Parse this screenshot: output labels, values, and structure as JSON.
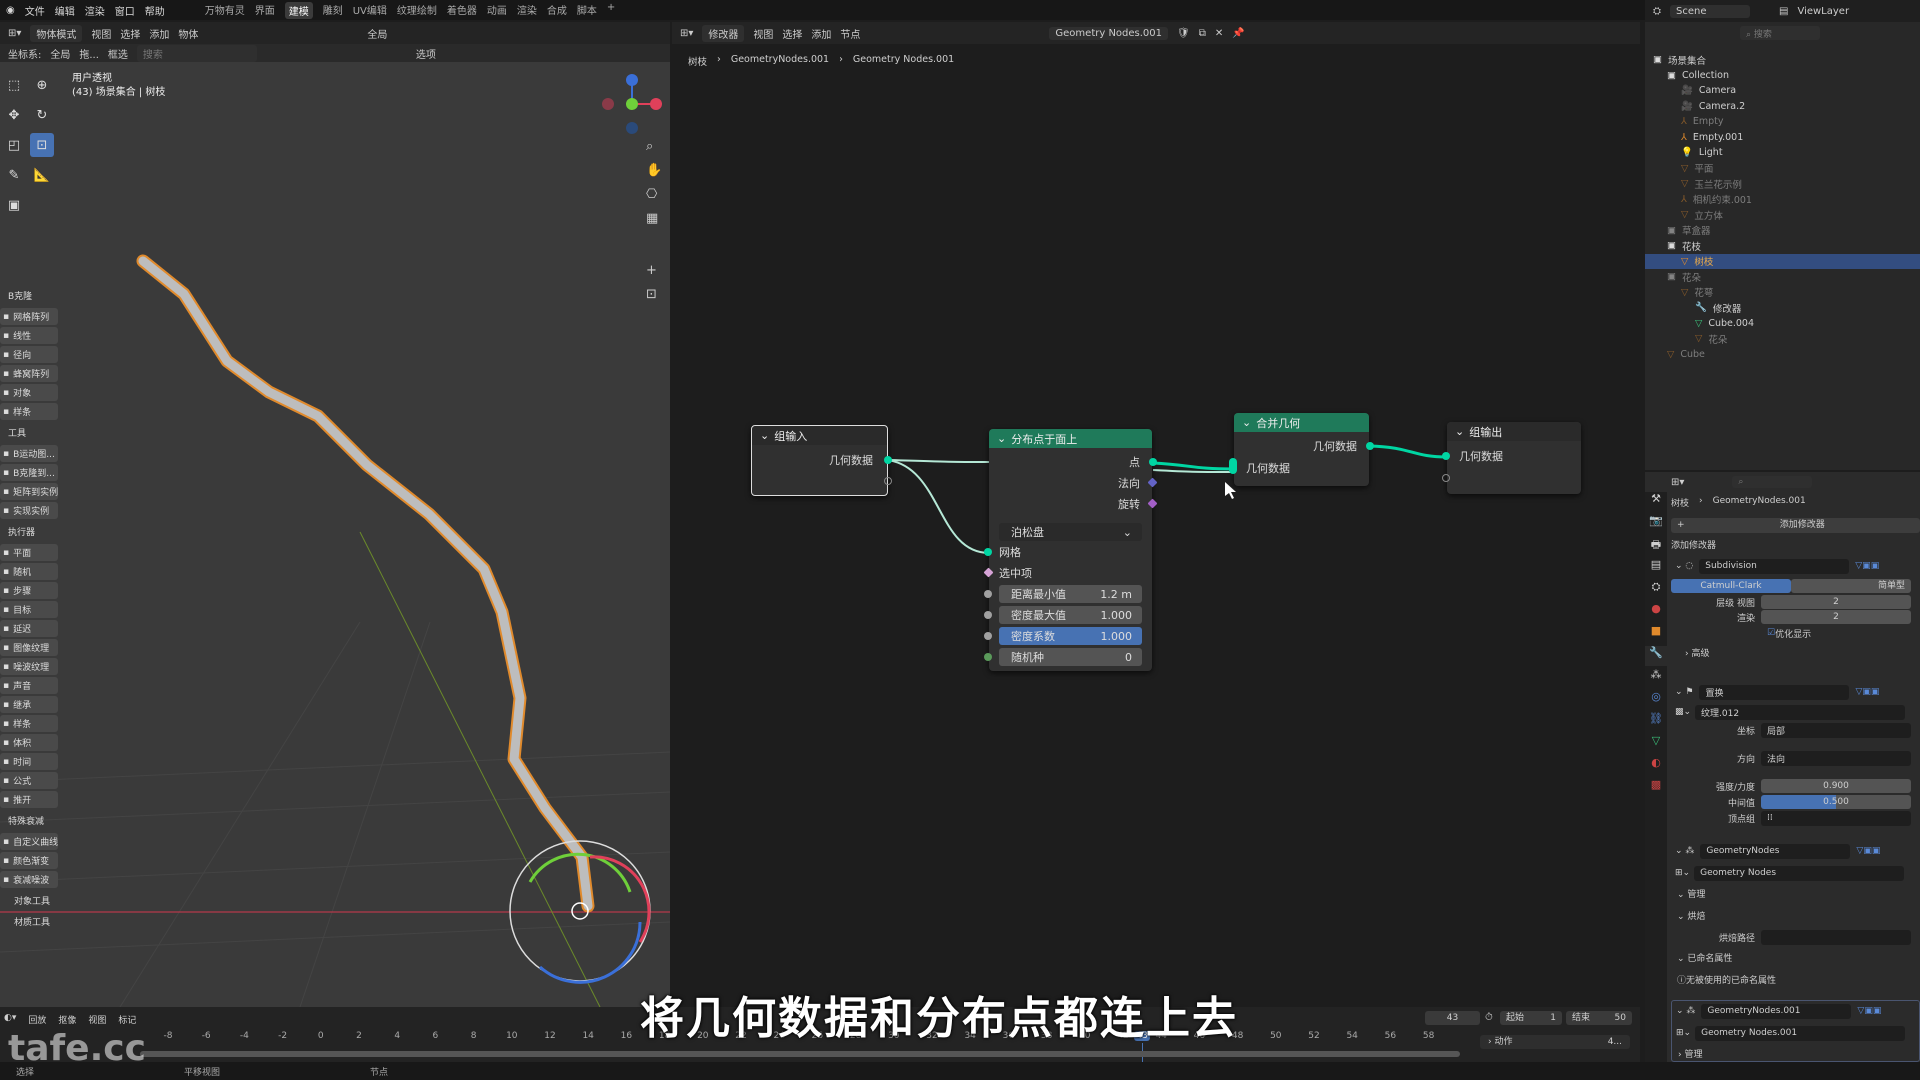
{
  "menu": {
    "items": [
      "文件",
      "编辑",
      "渲染",
      "窗口",
      "帮助"
    ],
    "workspaces": [
      "万物有灵",
      "界面",
      "建模",
      "雕刻",
      "UV编辑",
      "纹理绘制",
      "着色器",
      "动画",
      "渲染",
      "合成",
      "脚本",
      "+"
    ],
    "active_workspace": "建模"
  },
  "viewport_header": {
    "mode": "物体模式",
    "menus": [
      "视图",
      "选择",
      "添加",
      "物体"
    ],
    "transform": "全局",
    "coords_label": "坐标系:",
    "coords_value": "全局",
    "drag": "拖...",
    "select": "框选",
    "options": "选项",
    "search_placeholder": "搜索"
  },
  "viewport": {
    "view_name": "用户透视",
    "scene_info": "(43) 场景集合 | 树枝"
  },
  "toolbox": {
    "sections": [
      {
        "title": "B克隆",
        "items": [
          "网格阵列",
          "线性",
          "径向",
          "蜂窝阵列",
          "对象",
          "样条"
        ]
      },
      {
        "title": "工具",
        "items": [
          "B运动图...",
          "B克隆到...",
          "矩阵到实例",
          "实现实例"
        ]
      },
      {
        "title": "执行器",
        "items": [
          "平面",
          "随机",
          "步骤",
          "目标",
          "延迟",
          "图像纹理",
          "噪波纹理",
          "声音",
          "继承",
          "样条",
          "体积",
          "时间",
          "公式",
          "推开"
        ]
      },
      {
        "title": "特殊衰减",
        "items": [
          "自定义曲线",
          "颜色渐变",
          "衰减噪波"
        ]
      }
    ],
    "footer": [
      "对象工具",
      "材质工具"
    ]
  },
  "node_editor": {
    "header": {
      "editor": "修改器",
      "menus": [
        "视图",
        "选择",
        "添加",
        "节点"
      ],
      "node_group": "Geometry Nodes.001"
    },
    "breadcrumb": [
      "树枝",
      "GeometryNodes.001",
      "Geometry Nodes.001"
    ],
    "nodes": {
      "group_input": {
        "title": "组输入",
        "out": "几何数据"
      },
      "distribute": {
        "title": "分布点于面上",
        "outputs": [
          "点",
          "法向",
          "旋转"
        ],
        "mode": "泊松盘",
        "inputs": [
          "网格",
          "选中项"
        ],
        "fields": [
          {
            "label": "距离最小值",
            "value": "1.2 m"
          },
          {
            "label": "密度最大值",
            "value": "1.000"
          },
          {
            "label": "密度系数",
            "value": "1.000"
          },
          {
            "label": "随机种",
            "value": "0"
          }
        ]
      },
      "join": {
        "title": "合并几何",
        "out": "几何数据",
        "in": "几何数据"
      },
      "group_output": {
        "title": "组输出",
        "in": "几何数据"
      }
    },
    "colors": {
      "geometry": "#00d6a3",
      "header_green": "#1f7a5a",
      "vector": "#6363c7",
      "selected_field": "#4772b3"
    }
  },
  "outliner": {
    "scene": "Scene",
    "view_layer": "ViewLayer",
    "search_placeholder": "搜索",
    "rows": [
      {
        "label": "场景集合",
        "indent": 0,
        "icon": "collection-icon",
        "dim": false
      },
      {
        "label": "Collection",
        "indent": 1,
        "icon": "collection-icon",
        "dim": false
      },
      {
        "label": "Camera",
        "indent": 2,
        "icon": "camera-icon",
        "dim": false
      },
      {
        "label": "Camera.2",
        "indent": 2,
        "icon": "camera-icon",
        "dim": false
      },
      {
        "label": "Empty",
        "indent": 2,
        "icon": "empty-icon",
        "dim": true
      },
      {
        "label": "Empty.001",
        "indent": 2,
        "icon": "empty-icon",
        "dim": false
      },
      {
        "label": "Light",
        "indent": 2,
        "icon": "light-icon",
        "dim": false
      },
      {
        "label": "平面",
        "indent": 2,
        "icon": "mesh-icon",
        "dim": true
      },
      {
        "label": "玉兰花示例",
        "indent": 2,
        "icon": "mesh-icon",
        "dim": true
      },
      {
        "label": "相机约束.001",
        "indent": 2,
        "icon": "empty-icon",
        "dim": true
      },
      {
        "label": "立方体",
        "indent": 2,
        "icon": "mesh-icon",
        "dim": true
      },
      {
        "label": "草盒器",
        "indent": 1,
        "icon": "collection-icon",
        "dim": true
      },
      {
        "label": "花枝",
        "indent": 1,
        "icon": "collection-icon",
        "dim": false
      },
      {
        "label": "树枝",
        "indent": 2,
        "icon": "mesh-icon",
        "dim": false,
        "selected": true
      },
      {
        "label": "花朵",
        "indent": 1,
        "icon": "collection-icon",
        "dim": true
      },
      {
        "label": "花萼",
        "indent": 2,
        "icon": "mesh-icon",
        "dim": true
      },
      {
        "label": "修改器",
        "indent": 3,
        "icon": "wrench-icon",
        "dim": false
      },
      {
        "label": "Cube.004",
        "indent": 3,
        "icon": "mesh-data-icon",
        "dim": false
      },
      {
        "label": "花朵",
        "indent": 3,
        "icon": "mesh-icon",
        "dim": true
      },
      {
        "label": "Cube",
        "indent": 1,
        "icon": "mesh-icon",
        "dim": true
      }
    ]
  },
  "properties": {
    "breadcrumb": [
      "树枝",
      "GeometryNodes.001"
    ],
    "add_modifier": "添加修改器",
    "add_modifier_label": "添加修改器",
    "subdivision": {
      "name": "Subdivision",
      "modes": [
        "Catmull-Clark",
        "简单型"
      ],
      "levels_label": "层级 视图",
      "levels": "2",
      "render_label": "渲染",
      "render": "2",
      "optimize": "优化显示",
      "advanced": "高级"
    },
    "displace": {
      "name": "置换",
      "texture": "纹理.012",
      "coords_label": "坐标",
      "coords": "局部",
      "dir_label": "方向",
      "dir": "法向",
      "strength_label": "强度/力度",
      "strength": "0.900",
      "mid_label": "中间值",
      "mid": "0.500",
      "mid_fraction": 0.5,
      "vgroup_label": "顶点组"
    },
    "geonodes": {
      "name": "GeometryNodes",
      "group": "Geometry Nodes",
      "manage": "管理",
      "bake": "烘焙",
      "bake_path": "烘焙路径",
      "named_attrs": "已命名属性",
      "no_attrs": "无被使用的已命名属性"
    },
    "geonodes2": {
      "name": "GeometryNodes.001",
      "group": "Geometry Nodes.001",
      "manage": "管理"
    }
  },
  "timeline": {
    "menus": [
      "回放",
      "抠像",
      "视图",
      "标记"
    ],
    "current": "43",
    "start_label": "起始",
    "start": "1",
    "end_label": "结束",
    "end": "50",
    "ticks": [
      "-8",
      "-6",
      "-4",
      "-2",
      "0",
      "2",
      "4",
      "6",
      "8",
      "10",
      "12",
      "14",
      "16",
      "18",
      "20",
      "22",
      "24",
      "26",
      "28",
      "30",
      "32",
      "34",
      "36",
      "38",
      "40",
      "42",
      "43",
      "44",
      "46",
      "48",
      "50",
      "52",
      "54",
      "56",
      "58"
    ],
    "action": "动作",
    "action_value": "4..."
  },
  "status": [
    "选择",
    "平移视图",
    "节点"
  ],
  "subtitle": "将几何数据和分布点都连上去",
  "watermark": "tafe.cc"
}
